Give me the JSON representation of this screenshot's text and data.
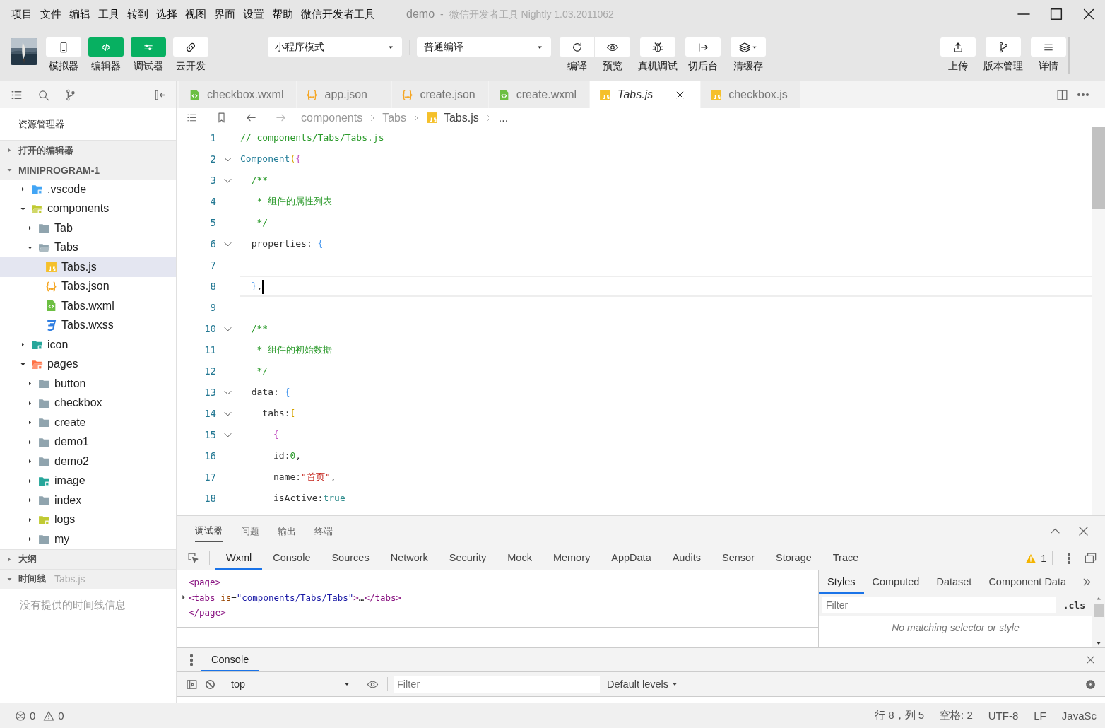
{
  "menu": [
    "项目",
    "文件",
    "编辑",
    "工具",
    "转到",
    "选择",
    "视图",
    "界面",
    "设置",
    "帮助",
    "微信开发者工具"
  ],
  "window": {
    "title": "demo",
    "separator": "-",
    "subtitle": "微信开发者工具 Nightly 1.03.2011062"
  },
  "toolbar": {
    "view_buttons": [
      {
        "label": "模拟器",
        "on": false
      },
      {
        "label": "编辑器",
        "on": true
      },
      {
        "label": "调试器",
        "on": true
      },
      {
        "label": "云开发",
        "on": false
      }
    ],
    "mode_select": "小程序模式",
    "compile_select": "普通编译",
    "actions": [
      "编译",
      "预览",
      "真机调试",
      "切后台",
      "清缓存"
    ],
    "right_actions": [
      "上传",
      "版本管理",
      "详情"
    ]
  },
  "sidebar": {
    "title": "资源管理器",
    "sections": [
      {
        "title": "打开的编辑器",
        "expanded": false
      },
      {
        "title": "MINIPROGRAM-1",
        "expanded": true,
        "tree": [
          {
            "label": ".vscode",
            "kind": "vscode",
            "expanded": false,
            "selected": false
          },
          {
            "label": "components",
            "kind": "components",
            "expanded": true,
            "selected": false,
            "children": [
              {
                "label": "Tab",
                "kind": "folder",
                "expanded": false,
                "selected": false
              },
              {
                "label": "Tabs",
                "kind": "folder",
                "expanded": true,
                "selected": false,
                "children": [
                  {
                    "label": "Tabs.js",
                    "kind": "js",
                    "selected": true
                  },
                  {
                    "label": "Tabs.json",
                    "kind": "json",
                    "selected": false
                  },
                  {
                    "label": "Tabs.wxml",
                    "kind": "wxml",
                    "selected": false
                  },
                  {
                    "label": "Tabs.wxss",
                    "kind": "wxss",
                    "selected": false
                  }
                ]
              }
            ]
          },
          {
            "label": "icon",
            "kind": "icons",
            "expanded": false,
            "selected": false
          },
          {
            "label": "pages",
            "kind": "pages",
            "expanded": true,
            "selected": false,
            "children": [
              {
                "label": "button",
                "kind": "folder",
                "expanded": false,
                "selected": false
              },
              {
                "label": "checkbox",
                "kind": "folder",
                "expanded": false,
                "selected": false
              },
              {
                "label": "create",
                "kind": "folder",
                "expanded": false,
                "selected": false
              },
              {
                "label": "demo1",
                "kind": "folder",
                "expanded": false,
                "selected": false
              },
              {
                "label": "demo2",
                "kind": "folder",
                "expanded": false,
                "selected": false
              },
              {
                "label": "image",
                "kind": "images",
                "expanded": false,
                "selected": false
              },
              {
                "label": "index",
                "kind": "folder",
                "expanded": false,
                "selected": false
              },
              {
                "label": "logs",
                "kind": "logs",
                "expanded": false,
                "selected": false
              },
              {
                "label": "my",
                "kind": "folder",
                "expanded": false,
                "selected": false
              }
            ]
          }
        ]
      },
      {
        "title": "大纲",
        "expanded": false
      },
      {
        "title": "时间线",
        "expanded": true,
        "detail": "Tabs.js",
        "message": "没有提供的时间线信息"
      }
    ]
  },
  "editor": {
    "tabs": [
      {
        "label": "checkbox.wxml",
        "kind": "wxml",
        "selected": false
      },
      {
        "label": "app.json",
        "kind": "json",
        "selected": false
      },
      {
        "label": "create.json",
        "kind": "json",
        "selected": false
      },
      {
        "label": "create.wxml",
        "kind": "wxml",
        "selected": false
      },
      {
        "label": "Tabs.js",
        "kind": "js",
        "selected": true
      },
      {
        "label": "checkbox.js",
        "kind": "js",
        "selected": false
      }
    ],
    "breadcrumb": [
      {
        "label": "components",
        "kind": "folder"
      },
      {
        "label": "Tabs",
        "kind": "folder"
      },
      {
        "label": "Tabs.js",
        "kind": "js"
      },
      {
        "label": "...",
        "kind": "more"
      }
    ],
    "lines": [
      {
        "number": "1",
        "fold": false,
        "current": false,
        "tokens": [
          {
            "kind": "comment",
            "text": "// components/Tabs/Tabs.js"
          }
        ]
      },
      {
        "number": "2",
        "fold": true,
        "current": false,
        "tokens": [
          {
            "kind": "func",
            "text": "Component"
          },
          {
            "kind": "bracket1",
            "text": "("
          },
          {
            "kind": "bracket2",
            "text": "{"
          }
        ]
      },
      {
        "number": "3",
        "fold": true,
        "current": false,
        "tokens": [
          {
            "kind": "comment",
            "text": "  /**"
          }
        ]
      },
      {
        "number": "4",
        "fold": false,
        "current": false,
        "tokens": [
          {
            "kind": "comment",
            "text": "   * 组件的属性列表"
          }
        ]
      },
      {
        "number": "5",
        "fold": false,
        "current": false,
        "tokens": [
          {
            "kind": "comment",
            "text": "   */"
          }
        ]
      },
      {
        "number": "6",
        "fold": true,
        "current": false,
        "tokens": [
          {
            "kind": "prop",
            "text": "  properties"
          },
          {
            "kind": "punct",
            "text": ": "
          },
          {
            "kind": "bracket3",
            "text": "{"
          }
        ]
      },
      {
        "number": "7",
        "fold": false,
        "current": false
      },
      {
        "number": "8",
        "fold": false,
        "current": true,
        "tokens": [
          {
            "kind": "bracket3",
            "text": "  }"
          },
          {
            "kind": "punct",
            "text": ","
          }
        ]
      },
      {
        "number": "9",
        "fold": false,
        "current": false
      },
      {
        "number": "10",
        "fold": true,
        "current": false,
        "tokens": [
          {
            "kind": "comment",
            "text": "  /**"
          }
        ]
      },
      {
        "number": "11",
        "fold": false,
        "current": false,
        "tokens": [
          {
            "kind": "comment",
            "text": "   * 组件的初始数据"
          }
        ]
      },
      {
        "number": "12",
        "fold": false,
        "current": false,
        "tokens": [
          {
            "kind": "comment",
            "text": "   */"
          }
        ]
      },
      {
        "number": "13",
        "fold": true,
        "current": false,
        "tokens": [
          {
            "kind": "prop",
            "text": "  data"
          },
          {
            "kind": "punct",
            "text": ": "
          },
          {
            "kind": "bracket3",
            "text": "{"
          }
        ]
      },
      {
        "number": "14",
        "fold": true,
        "current": false,
        "tokens": [
          {
            "kind": "prop",
            "text": "    tabs"
          },
          {
            "kind": "punct",
            "text": ":"
          },
          {
            "kind": "bracket1",
            "text": "["
          }
        ]
      },
      {
        "number": "15",
        "fold": true,
        "current": false,
        "tokens": [
          {
            "kind": "bracket2",
            "text": "      {"
          }
        ]
      },
      {
        "number": "16",
        "fold": false,
        "current": false,
        "tokens": [
          {
            "kind": "prop",
            "text": "      id"
          },
          {
            "kind": "punct",
            "text": ":"
          },
          {
            "kind": "number",
            "text": "0"
          },
          {
            "kind": "punct",
            "text": ","
          }
        ]
      },
      {
        "number": "17",
        "fold": false,
        "current": false,
        "tokens": [
          {
            "kind": "prop",
            "text": "      name"
          },
          {
            "kind": "punct",
            "text": ":"
          },
          {
            "kind": "string",
            "text": "\"首页\""
          },
          {
            "kind": "punct",
            "text": ","
          }
        ]
      },
      {
        "number": "18",
        "fold": false,
        "current": false,
        "tokens": [
          {
            "kind": "prop",
            "text": "      isActive"
          },
          {
            "kind": "punct",
            "text": ":"
          },
          {
            "kind": "keyword",
            "text": "true"
          }
        ]
      }
    ]
  },
  "panel": {
    "tabs": [
      {
        "label": "调试器",
        "selected": true
      },
      {
        "label": "问题",
        "selected": false
      },
      {
        "label": "输出",
        "selected": false
      },
      {
        "label": "终端",
        "selected": false
      }
    ],
    "devtools_tabs": [
      {
        "label": "Wxml",
        "selected": true
      },
      {
        "label": "Console",
        "selected": false
      },
      {
        "label": "Sources",
        "selected": false
      },
      {
        "label": "Network",
        "selected": false
      },
      {
        "label": "Security",
        "selected": false
      },
      {
        "label": "Mock",
        "selected": false
      },
      {
        "label": "Memory",
        "selected": false
      },
      {
        "label": "AppData",
        "selected": false
      },
      {
        "label": "Audits",
        "selected": false
      },
      {
        "label": "Sensor",
        "selected": false
      },
      {
        "label": "Storage",
        "selected": false
      },
      {
        "label": "Trace",
        "selected": false
      }
    ],
    "warnings": "1",
    "wxml": [
      {
        "kind": "plain",
        "tokens": [
          {
            "kind": "tag",
            "text": "<page>"
          }
        ]
      },
      {
        "kind": "expandable",
        "tokens": [
          {
            "kind": "tag",
            "text": "<tabs"
          },
          {
            "kind": "attr",
            "text": " is"
          },
          {
            "kind": "text",
            "text": "="
          },
          {
            "kind": "value",
            "text": "\"components/Tabs/Tabs\""
          },
          {
            "kind": "tag",
            "text": ">"
          },
          {
            "kind": "text",
            "text": "…"
          },
          {
            "kind": "tag",
            "text": "</tabs>"
          }
        ]
      },
      {
        "kind": "plain",
        "tokens": [
          {
            "kind": "tag",
            "text": "</page>"
          }
        ]
      }
    ],
    "styles_tabs": [
      {
        "label": "Styles",
        "selected": true
      },
      {
        "label": "Computed",
        "selected": false
      },
      {
        "label": "Dataset",
        "selected": false
      },
      {
        "label": "Component Data",
        "selected": false
      }
    ],
    "styles_filter": {
      "placeholder": "Filter"
    },
    "cls": ".cls",
    "styles_empty": "No matching selector or style",
    "drawer_tabs": [
      {
        "label": "Console",
        "selected": true
      }
    ],
    "console": {
      "context": "top",
      "filter": {
        "placeholder": "Filter"
      },
      "levels": "Default levels"
    }
  },
  "status_bar": {
    "errors": "0",
    "warnings": "0",
    "items": [
      "行 8，列 5",
      "空格: 2",
      "UTF-8",
      "LF",
      "JavaSc"
    ]
  }
}
